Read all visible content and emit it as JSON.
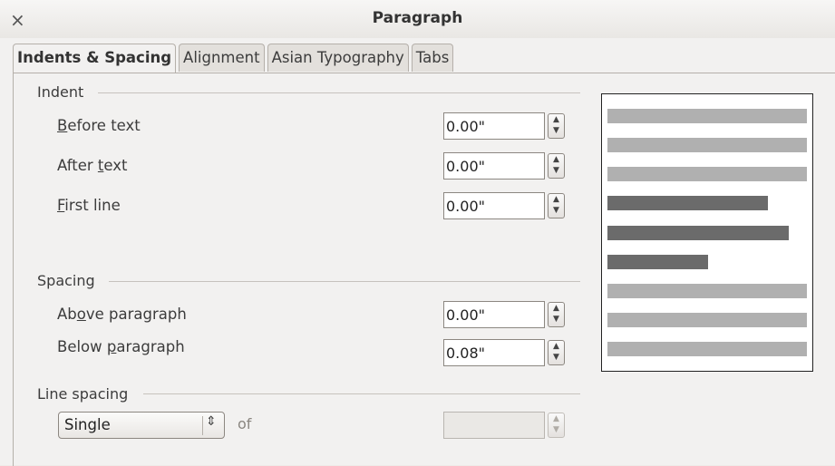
{
  "window": {
    "title": "Paragraph",
    "close_glyph": "×"
  },
  "tabs": [
    {
      "label": "Indents & Spacing",
      "active": true
    },
    {
      "label": "Alignment",
      "active": false
    },
    {
      "label": "Asian Typography",
      "active": false
    },
    {
      "label": "Tabs",
      "active": false
    }
  ],
  "indent": {
    "heading": "Indent",
    "before_text": {
      "label_pre": "",
      "label_u": "B",
      "label_post": "efore text",
      "value": "0.00\""
    },
    "after_text": {
      "label_pre": "After ",
      "label_u": "t",
      "label_post": "ext",
      "value": "0.00\""
    },
    "first_line": {
      "label_pre": "",
      "label_u": "F",
      "label_post": "irst line",
      "value": "0.00\""
    }
  },
  "spacing": {
    "heading": "Spacing",
    "above_paragraph": {
      "label_pre": "Ab",
      "label_u": "o",
      "label_post": "ve paragraph",
      "value": "0.00\""
    },
    "below_paragraph": {
      "label_pre": "Below ",
      "label_u": "p",
      "label_post": "aragraph",
      "value": "0.08\""
    }
  },
  "line_spacing": {
    "heading": "Line spacing",
    "selected": "Single",
    "of_label": "of",
    "of_value": ""
  },
  "colors": {
    "preview_light": "#b0b0b0",
    "preview_dark": "#6b6b6b"
  }
}
